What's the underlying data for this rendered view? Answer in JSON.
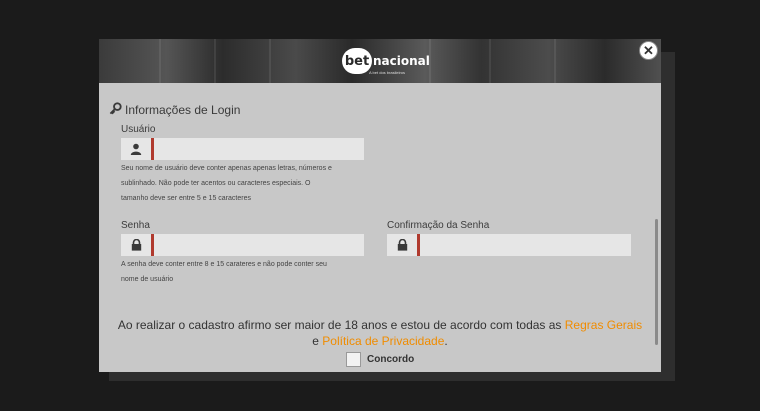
{
  "banner": {
    "logo_bet": "bet",
    "logo_nacional": "nacional",
    "tagline": "A bet dos brasileiros",
    "close_label": "✕"
  },
  "login_section": {
    "title": "Informações de Login",
    "icon": "key-icon"
  },
  "username": {
    "label": "Usuário",
    "value": "",
    "icon": "user-icon",
    "hint_lines": [
      "Seu nome de usuário deve conter apenas apenas letras, números e",
      "sublinhado. Não pode ter acentos ou caracteres especiais. O",
      "tamanho deve ser entre 5 e 15 caracteres"
    ]
  },
  "password": {
    "label": "Senha",
    "value": "",
    "icon": "lock-icon",
    "hint_lines": [
      "A senha deve conter entre 8 e 15 carateres e não pode conter seu",
      "nome de usuário"
    ]
  },
  "password_confirm": {
    "label": "Confirmação da Senha",
    "value": "",
    "icon": "lock-icon"
  },
  "consent": {
    "text_before": "Ao realizar o cadastro afirmo ser maior de 18 anos e estou de acordo com todas as ",
    "terms_link": "Regras Gerais",
    "text_and": "e ",
    "privacy_link": "Política de Privacidade",
    "text_end": ".",
    "agree_label": "Concordo"
  },
  "colors": {
    "accent_link": "#f08c00",
    "input_bar": "#b03a2e"
  }
}
